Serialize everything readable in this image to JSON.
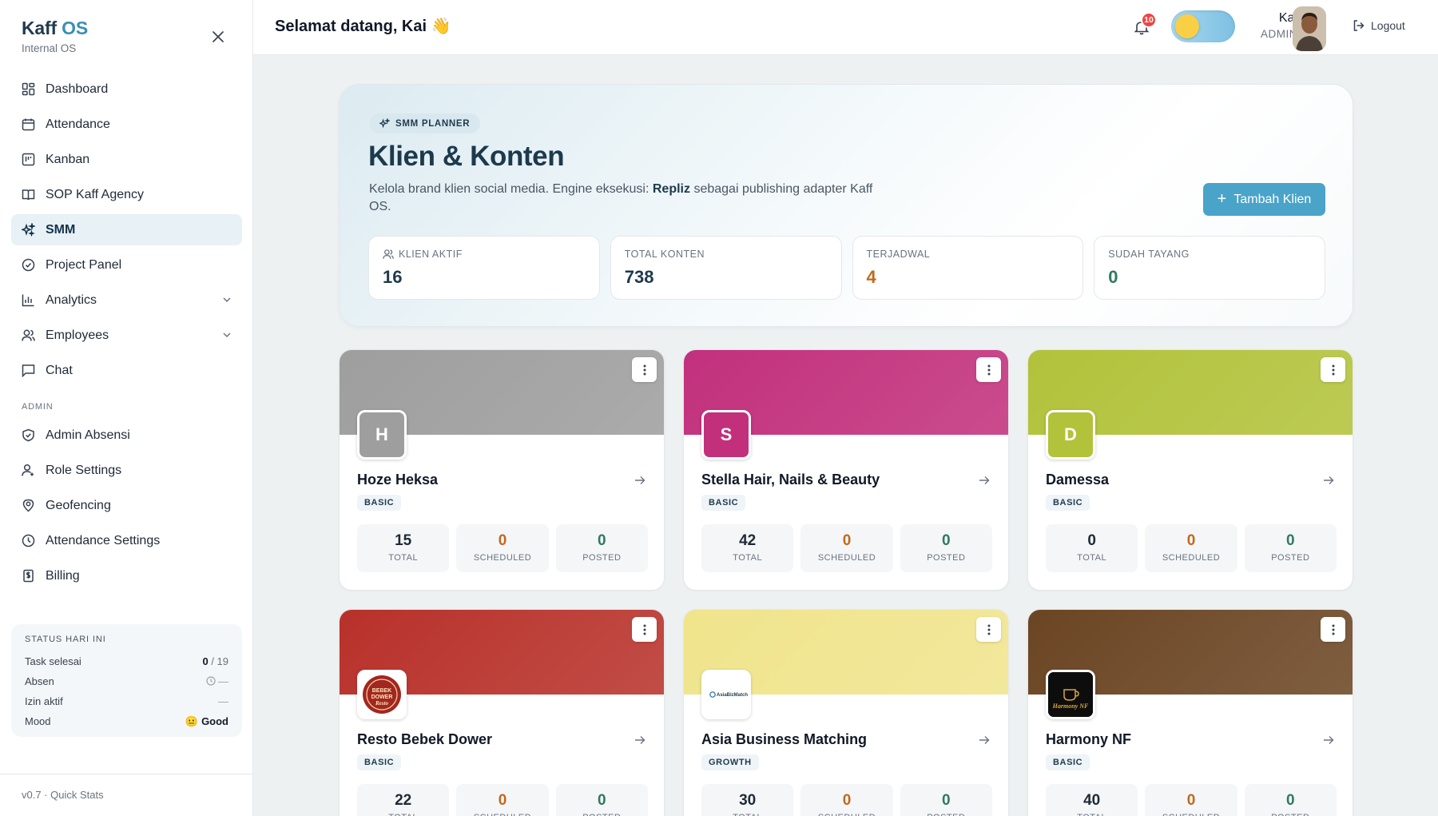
{
  "brand": {
    "title_main": "Kaff",
    "title_accent": "OS",
    "subtitle": "Internal OS"
  },
  "nav": {
    "items": [
      {
        "label": "Dashboard",
        "icon": "dashboard-icon"
      },
      {
        "label": "Attendance",
        "icon": "calendar-icon"
      },
      {
        "label": "Kanban",
        "icon": "kanban-icon"
      },
      {
        "label": "SOP Kaff Agency",
        "icon": "book-icon"
      },
      {
        "label": "SMM",
        "icon": "sparkles-icon",
        "active": true
      },
      {
        "label": "Project Panel",
        "icon": "check-circle-icon"
      },
      {
        "label": "Analytics",
        "icon": "bar-chart-icon",
        "expandable": true
      },
      {
        "label": "Employees",
        "icon": "users-icon",
        "expandable": true
      },
      {
        "label": "Chat",
        "icon": "chat-icon"
      }
    ],
    "admin_section": "ADMIN",
    "admin_items": [
      {
        "label": "Admin Absensi",
        "icon": "shield-icon"
      },
      {
        "label": "Role Settings",
        "icon": "user-settings-icon"
      },
      {
        "label": "Geofencing",
        "icon": "map-pin-icon"
      },
      {
        "label": "Attendance Settings",
        "icon": "clock-icon"
      },
      {
        "label": "Billing",
        "icon": "receipt-icon"
      }
    ]
  },
  "status": {
    "title": "STATUS HARI INI",
    "task_label": "Task selesai",
    "task_done": "0",
    "task_total": " / 19",
    "absen_label": "Absen",
    "absen_value": "—",
    "izin_label": "Izin aktif",
    "izin_value": "—",
    "mood_label": "Mood",
    "mood_emoji": "😐",
    "mood_value": "Good"
  },
  "footer": "v0.7 · Quick Stats",
  "topbar": {
    "greeting": "Selamat datang, Kai 👋",
    "notification_count": "10",
    "user_name": "Kai",
    "user_role": "ADMIN",
    "logout_label": "Logout"
  },
  "hero": {
    "pill": "SMM PLANNER",
    "title": "Klien & Konten",
    "desc_before": "Kelola brand klien social media. Engine eksekusi: ",
    "desc_bold": "Repliz",
    "desc_after": " sebagai publishing adapter Kaff OS.",
    "add_button": "Tambah Klien",
    "stats": [
      {
        "label": "KLIEN AKTIF",
        "value": "16",
        "color": "#1d3a4c"
      },
      {
        "label": "TOTAL KONTEN",
        "value": "738",
        "color": "#1d3a4c"
      },
      {
        "label": "TERJADWAL",
        "value": "4",
        "color": "#c2691b"
      },
      {
        "label": "SUDAH TAYANG",
        "value": "0",
        "color": "#2f7a5f"
      }
    ]
  },
  "mini_labels": {
    "total": "TOTAL",
    "scheduled": "SCHEDULED",
    "posted": "POSTED"
  },
  "clients": [
    {
      "name": "Hoze Heksa",
      "tier": "BASIC",
      "initial": "H",
      "color": "#9e9e9e",
      "total": "15",
      "scheduled": "0",
      "posted": "0"
    },
    {
      "name": "Stella Hair, Nails & Beauty",
      "tier": "BASIC",
      "initial": "S",
      "color": "#c2307c",
      "total": "42",
      "scheduled": "0",
      "posted": "0"
    },
    {
      "name": "Damessa",
      "tier": "BASIC",
      "initial": "D",
      "color": "#b2c23a",
      "total": "0",
      "scheduled": "0",
      "posted": "0"
    },
    {
      "name": "Resto Bebek Dower",
      "tier": "BASIC",
      "initial": "",
      "color": "#b8312a",
      "total": "22",
      "scheduled": "0",
      "posted": "0"
    },
    {
      "name": "Asia Business Matching",
      "tier": "GROWTH",
      "initial": "",
      "color": "#f0e48c",
      "total": "30",
      "scheduled": "0",
      "posted": "0"
    },
    {
      "name": "Harmony NF",
      "tier": "BASIC",
      "initial": "",
      "color": "#6b4523",
      "total": "40",
      "scheduled": "0",
      "posted": "0"
    }
  ],
  "logo_texts": {
    "bebek": "BEBEK DOWER Resto",
    "asia": "AsiaBizMatch",
    "harmony": "Harmony NF"
  },
  "colors": {
    "accent": "#4aa3c9",
    "scheduled": "#c2691b",
    "posted": "#2f7a5f",
    "danger": "#ef4444"
  }
}
